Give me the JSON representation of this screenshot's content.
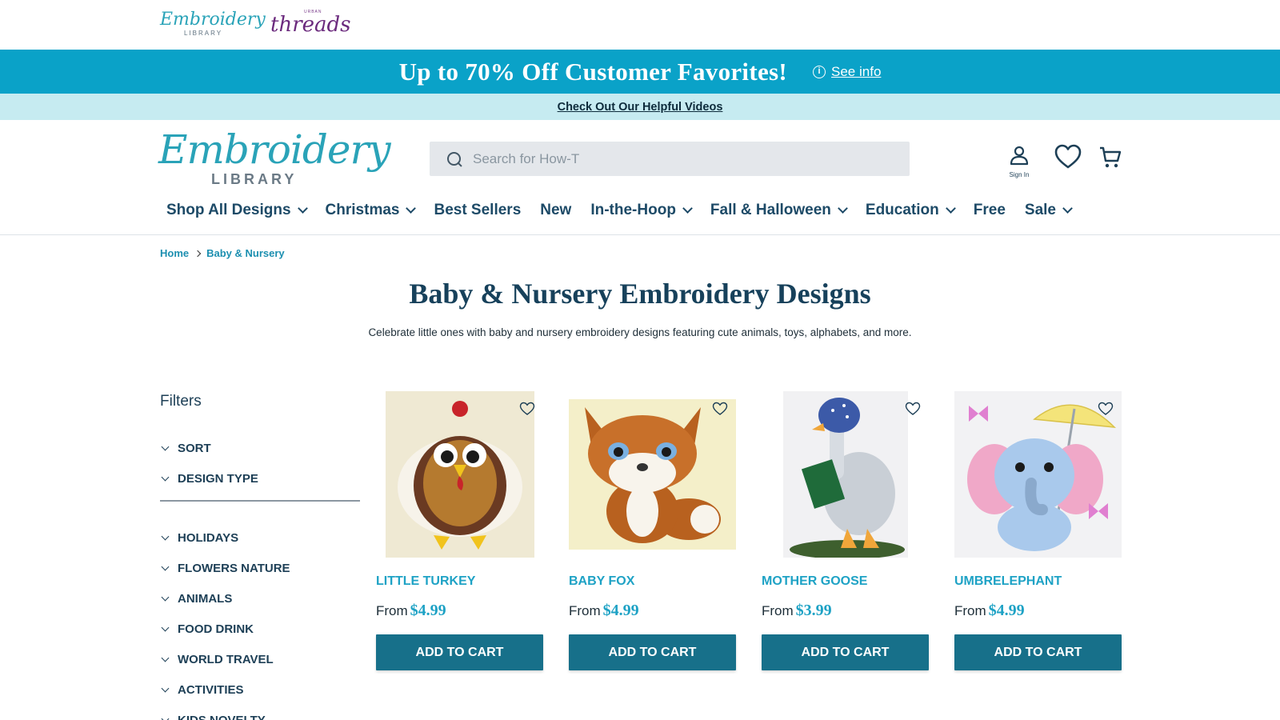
{
  "brand_bar": {
    "logo_small_script": "Embroidery",
    "logo_small_caps": "LIBRARY",
    "logo_ut_small": "URBAN",
    "logo_ut_script": "threads"
  },
  "promo": {
    "text": "Up to 70% Off Customer Favorites!",
    "info_label": "See info",
    "bg_color": "#0aa2c8"
  },
  "helpbar": {
    "link": "Check Out Our Helpful Videos",
    "bg_color": "#c6ebf1"
  },
  "header": {
    "logo_script": "Embroidery",
    "logo_caps": "LIBRARY",
    "search_placeholder": "Search for How-T",
    "account_label": "Sign In",
    "icons": [
      "account-icon",
      "heart-icon",
      "cart-icon"
    ]
  },
  "nav": {
    "items": [
      {
        "label": "Shop All Designs",
        "dropdown": true
      },
      {
        "label": "Christmas",
        "dropdown": true
      },
      {
        "label": "Best Sellers",
        "dropdown": false
      },
      {
        "label": "New",
        "dropdown": false
      },
      {
        "label": "In-the-Hoop",
        "dropdown": true
      },
      {
        "label": "Fall & Halloween",
        "dropdown": true
      },
      {
        "label": "Education",
        "dropdown": true
      },
      {
        "label": "Free",
        "dropdown": false
      },
      {
        "label": "Sale",
        "dropdown": true
      }
    ]
  },
  "breadcrumb": {
    "home": "Home",
    "current": "Baby & Nursery"
  },
  "page": {
    "title": "Baby & Nursery Embroidery Designs",
    "description": "Celebrate little ones with baby and nursery embroidery designs featuring cute animals, toys, alphabets, and more."
  },
  "filters": {
    "title": "Filters",
    "top": [
      "SORT",
      "DESIGN TYPE"
    ],
    "groups": [
      "HOLIDAYS",
      "FLOWERS NATURE",
      "ANIMALS",
      "FOOD DRINK",
      "WORLD TRAVEL",
      "ACTIVITIES",
      "KIDS NOVELTY"
    ]
  },
  "products": [
    {
      "name": "LITTLE TURKEY",
      "from": "From",
      "price": "$4.99",
      "button": "ADD TO CART"
    },
    {
      "name": "BABY FOX",
      "from": "From",
      "price": "$4.99",
      "button": "ADD TO CART"
    },
    {
      "name": "MOTHER GOOSE",
      "from": "From",
      "price": "$3.99",
      "button": "ADD TO CART"
    },
    {
      "name": "UMBRELEPHANT",
      "from": "From",
      "price": "$4.99",
      "button": "ADD TO CART"
    }
  ],
  "colors": {
    "accent": "#1ea2c5",
    "button": "#17708a",
    "heading": "#17415b"
  }
}
